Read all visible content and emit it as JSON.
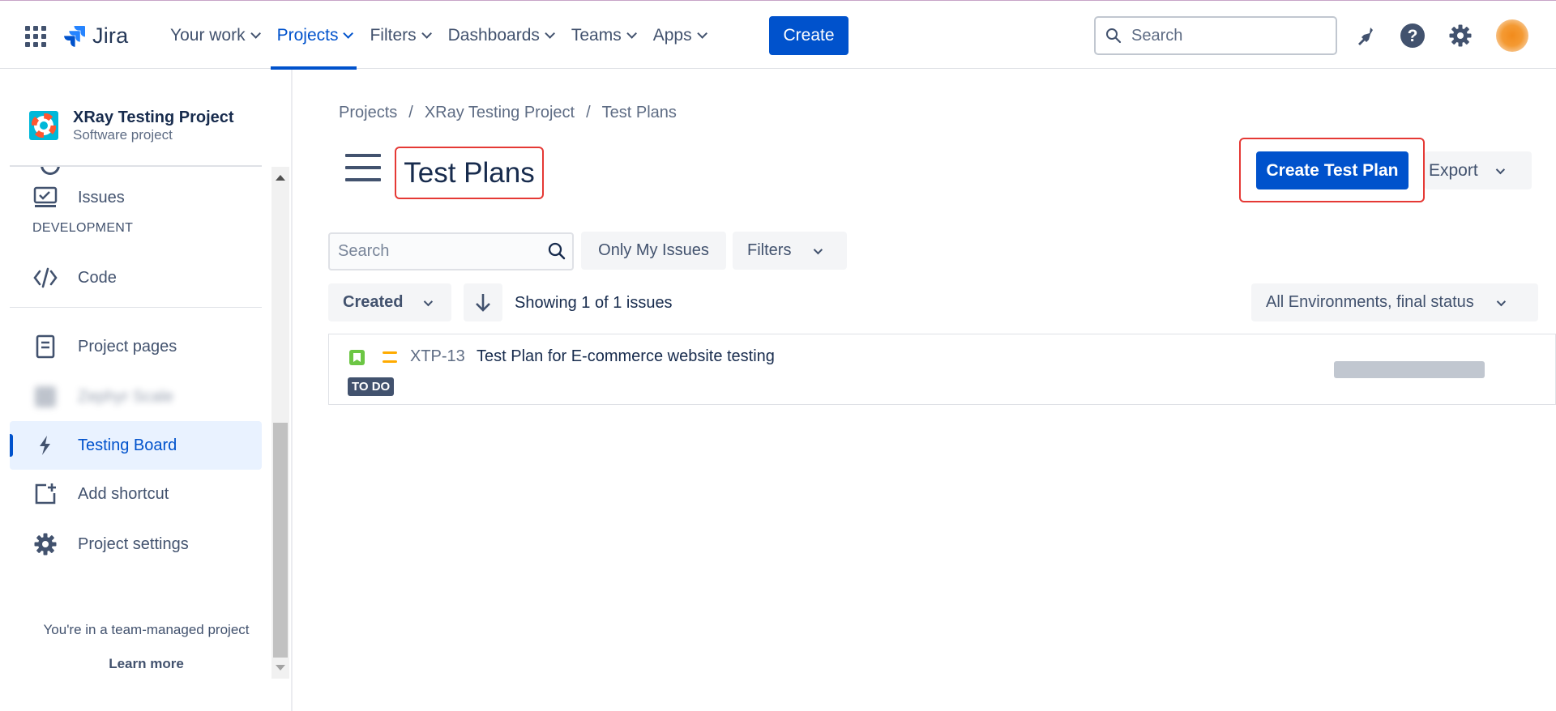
{
  "topbar": {
    "product_name": "Jira",
    "nav": [
      {
        "label": "Your work"
      },
      {
        "label": "Projects",
        "active": true
      },
      {
        "label": "Filters"
      },
      {
        "label": "Dashboards"
      },
      {
        "label": "Teams"
      },
      {
        "label": "Apps"
      }
    ],
    "create_label": "Create",
    "search_placeholder": "Search",
    "icons": [
      "app-switcher-icon",
      "notifications-icon",
      "help-icon",
      "settings-icon"
    ],
    "accent_color": "#0052cc"
  },
  "sidebar": {
    "project_name": "XRay Testing Project",
    "project_type": "Software project",
    "items": {
      "issues": "Issues",
      "development_heading": "DEVELOPMENT",
      "code": "Code",
      "project_pages": "Project pages",
      "zephyr_scale": "Zephyr Scale",
      "testing_board": "Testing Board",
      "add_shortcut": "Add shortcut",
      "project_settings": "Project settings"
    },
    "team_note": "You're in a team-managed project",
    "learn_more": "Learn more"
  },
  "main": {
    "breadcrumb": [
      "Projects",
      "XRay Testing Project",
      "Test Plans"
    ],
    "breadcrumb_separator": "/",
    "title": "Test Plans",
    "create_test_plan_label": "Create Test Plan",
    "export_label": "Export",
    "search_placeholder": "Search",
    "only_my_issues_label": "Only My Issues",
    "filters_label": "Filters",
    "sort_label": "Created",
    "showing_text": "Showing 1 of 1 issues",
    "environment_label": "All Environments, final status",
    "issues": [
      {
        "key": "XTP-13",
        "summary": "Test Plan for E-commerce website testing",
        "status": "TO DO"
      }
    ]
  }
}
